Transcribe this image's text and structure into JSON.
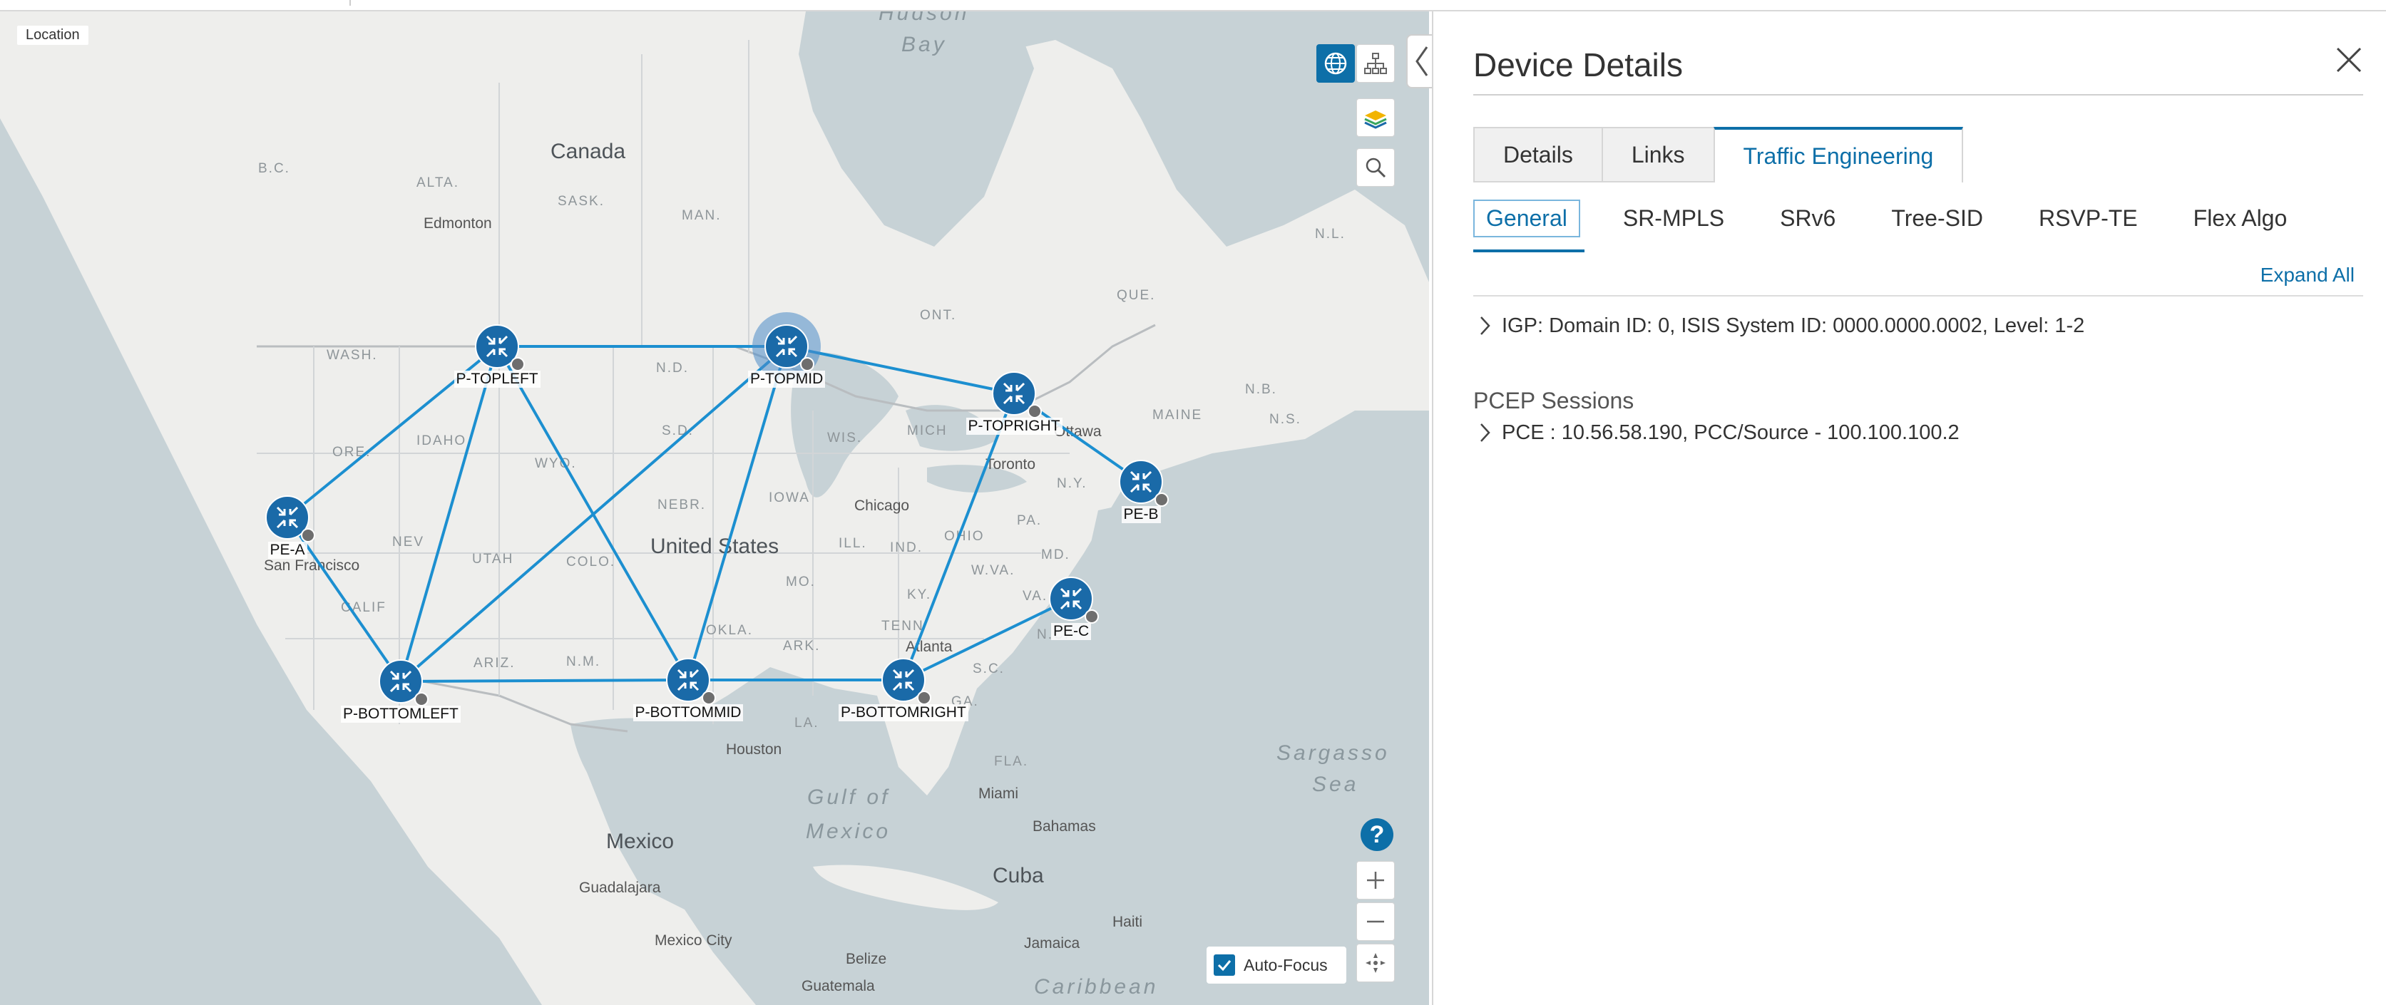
{
  "map": {
    "location_label": "Location",
    "auto_focus_label": "Auto-Focus",
    "help_glyph": "?",
    "labels": {
      "countries": [
        {
          "name": "Canada"
        },
        {
          "name": "United States"
        },
        {
          "name": "Mexico"
        },
        {
          "name": "Cuba"
        }
      ],
      "waters": [
        {
          "name": "Hudson"
        },
        {
          "name": "Bay"
        },
        {
          "name": "Gulf of"
        },
        {
          "name": "Mexico"
        },
        {
          "name": "Sargasso"
        },
        {
          "name": "Sea"
        },
        {
          "name": "Caribbean"
        }
      ],
      "states": [
        "B.C.",
        "ALTA.",
        "SASK.",
        "MAN.",
        "ONT.",
        "QUE.",
        "N.L.",
        "N.B.",
        "N.S.",
        "WASH.",
        "N.D.",
        "MAINE",
        "ORE.",
        "IDAHO",
        "S.D.",
        "WIS.",
        "MICH",
        "N.Y.",
        "WYO.",
        "IOWA",
        "PA.",
        "NEBR.",
        "NEV",
        "UTAH",
        "COLO.",
        "ILL.",
        "IND.",
        "OHIO",
        "MD.",
        "KY.",
        "W.VA.",
        "VA.",
        "CALIF",
        "MO.",
        "OKLA.",
        "ARK.",
        "TENN",
        "N.C.",
        "S.C.",
        "ARIZ.",
        "N.M.",
        "LA.",
        "GA.",
        "FLA."
      ],
      "cities": [
        "Edmonton",
        "Ottawa",
        "Toronto",
        "Chicago",
        "San Francisco",
        "Atlanta",
        "Houston",
        "Miami",
        "Bahamas",
        "Guadalajara",
        "Mexico City",
        "Haiti",
        "Jamaica",
        "Belize",
        "Guatemala"
      ]
    },
    "nodes": [
      {
        "id": "P-TOPLEFT",
        "label": "P-TOPLEFT"
      },
      {
        "id": "P-TOPMID",
        "label": "P-TOPMID",
        "selected": true
      },
      {
        "id": "P-TOPRIGHT",
        "label": "P-TOPRIGHT"
      },
      {
        "id": "PE-A",
        "label": "PE-A"
      },
      {
        "id": "PE-B",
        "label": "PE-B"
      },
      {
        "id": "PE-C",
        "label": "PE-C"
      },
      {
        "id": "P-BOTTOMLEFT",
        "label": "P-BOTTOMLEFT"
      },
      {
        "id": "P-BOTTOMMID",
        "label": "P-BOTTOMMID"
      },
      {
        "id": "P-BOTTOMRIGHT",
        "label": "P-BOTTOMRIGHT"
      }
    ],
    "links": [
      [
        "P-TOPLEFT",
        "P-TOPMID"
      ],
      [
        "P-TOPMID",
        "P-TOPRIGHT"
      ],
      [
        "P-TOPRIGHT",
        "PE-B"
      ],
      [
        "PE-A",
        "P-TOPLEFT"
      ],
      [
        "PE-A",
        "P-BOTTOMLEFT"
      ],
      [
        "P-TOPLEFT",
        "P-BOTTOMLEFT"
      ],
      [
        "P-TOPLEFT",
        "P-BOTTOMMID"
      ],
      [
        "P-TOPMID",
        "P-BOTTOMLEFT"
      ],
      [
        "P-TOPMID",
        "P-BOTTOMMID"
      ],
      [
        "P-BOTTOMLEFT",
        "P-BOTTOMMID"
      ],
      [
        "P-BOTTOMMID",
        "P-BOTTOMRIGHT"
      ],
      [
        "P-TOPRIGHT",
        "P-BOTTOMRIGHT"
      ],
      [
        "P-BOTTOMRIGHT",
        "PE-C"
      ]
    ],
    "colors": {
      "link": "#1c8fd0",
      "node": "#1a6aa8",
      "accent": "#0d6fa8"
    },
    "toolbar_icons": [
      "globe-icon",
      "topology-icon",
      "layers-icon",
      "search-icon"
    ],
    "zoom_icons": [
      "plus-icon",
      "minus-icon",
      "recenter-icon"
    ]
  },
  "panel": {
    "title": "Device Details",
    "tabs": [
      {
        "label": "Details"
      },
      {
        "label": "Links"
      },
      {
        "label": "Traffic Engineering",
        "active": true
      }
    ],
    "subtabs": [
      {
        "label": "General",
        "active": true
      },
      {
        "label": "SR-MPLS"
      },
      {
        "label": "SRv6"
      },
      {
        "label": "Tree-SID"
      },
      {
        "label": "RSVP-TE"
      },
      {
        "label": "Flex Algo"
      }
    ],
    "expand_all": "Expand All",
    "igp_row": "IGP: Domain ID: 0, ISIS System ID: 0000.0000.0002, Level: 1-2",
    "pcep_title": "PCEP Sessions",
    "pcep_row": "PCE : 10.56.58.190, PCC/Source - 100.100.100.2"
  }
}
